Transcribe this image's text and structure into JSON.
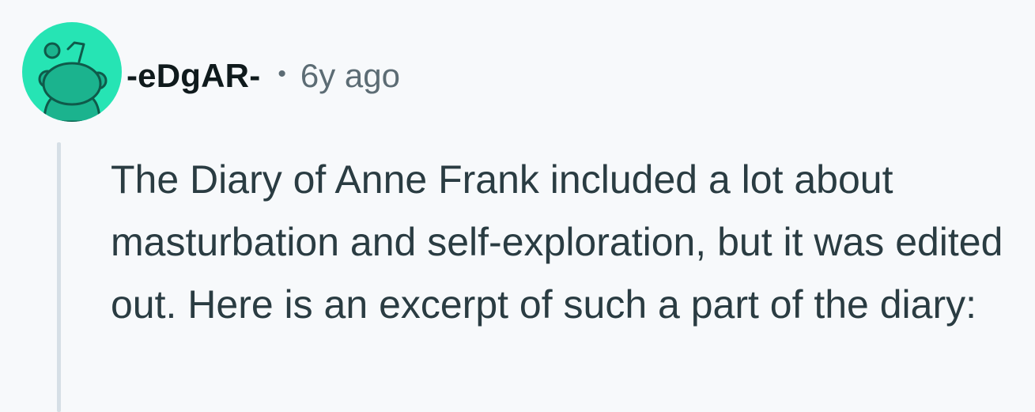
{
  "comment": {
    "username": "-eDgAR-",
    "separator": "•",
    "timestamp": "6y ago",
    "avatar_icon": "reddit-snoo-avatar-icon",
    "avatar_color": "#26e4b4",
    "body": "The Diary of Anne Frank included a lot about masturbation and self-exploration, but it was edited out. Here is an excerpt of such a part of the diary:"
  }
}
